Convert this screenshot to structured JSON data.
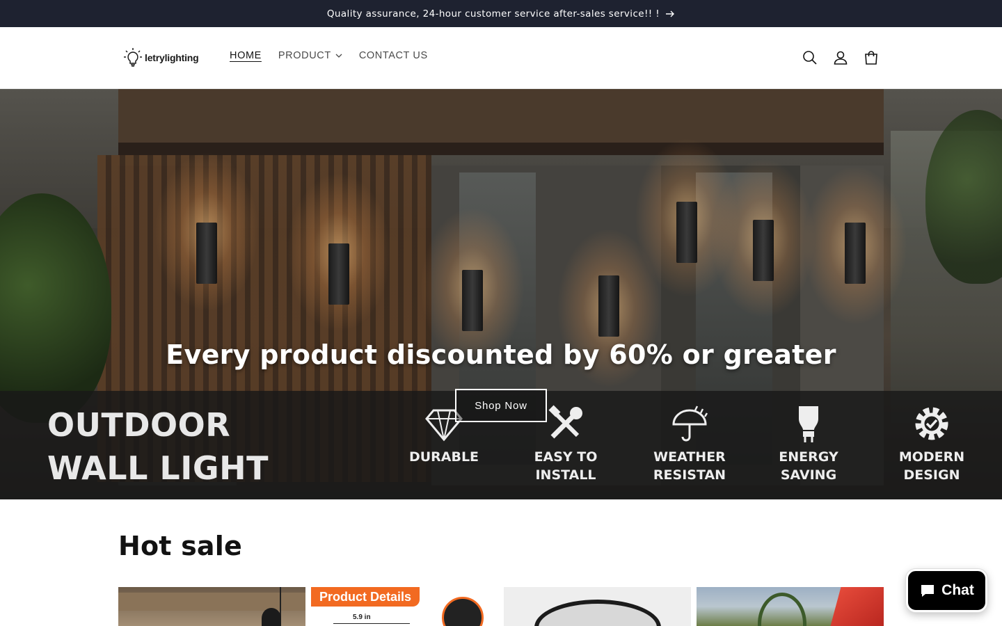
{
  "announcement": {
    "text": "Quality assurance, 24-hour customer service after-sales service!! !",
    "icon": "arrow-right-icon"
  },
  "header": {
    "logo_text": "letrylighting",
    "nav": [
      {
        "label": "HOME",
        "active": true
      },
      {
        "label": "PRODUCT",
        "has_dropdown": true
      },
      {
        "label": "CONTACT US"
      }
    ],
    "icons": [
      "search-icon",
      "account-icon",
      "cart-icon"
    ]
  },
  "hero": {
    "headline": "Every product discounted by 60% or greater",
    "button_label": "Shop Now",
    "banner_title_line1": "OUTDOOR",
    "banner_title_line2": "WALL LIGHT",
    "features": [
      {
        "line1": "DURABLE",
        "line2": "",
        "icon": "diamond-icon"
      },
      {
        "line1": "EASY TO",
        "line2": "INSTALL",
        "icon": "tools-icon"
      },
      {
        "line1": "WEATHER",
        "line2": "RESISTAN",
        "icon": "umbrella-icon"
      },
      {
        "line1": "ENERGY",
        "line2": "SAVING",
        "icon": "bulb-icon"
      },
      {
        "line1": "MODERN",
        "line2": "DESIGN",
        "icon": "gear-icon"
      }
    ]
  },
  "hot_sale": {
    "title": "Hot sale",
    "card2_badge": "Product Details",
    "card2_dimension": "5.9 in"
  },
  "chat": {
    "label": "Chat"
  },
  "colors": {
    "announce_bg": "#1e2230",
    "accent_orange": "#f26a21",
    "chat_bg": "#000000"
  }
}
